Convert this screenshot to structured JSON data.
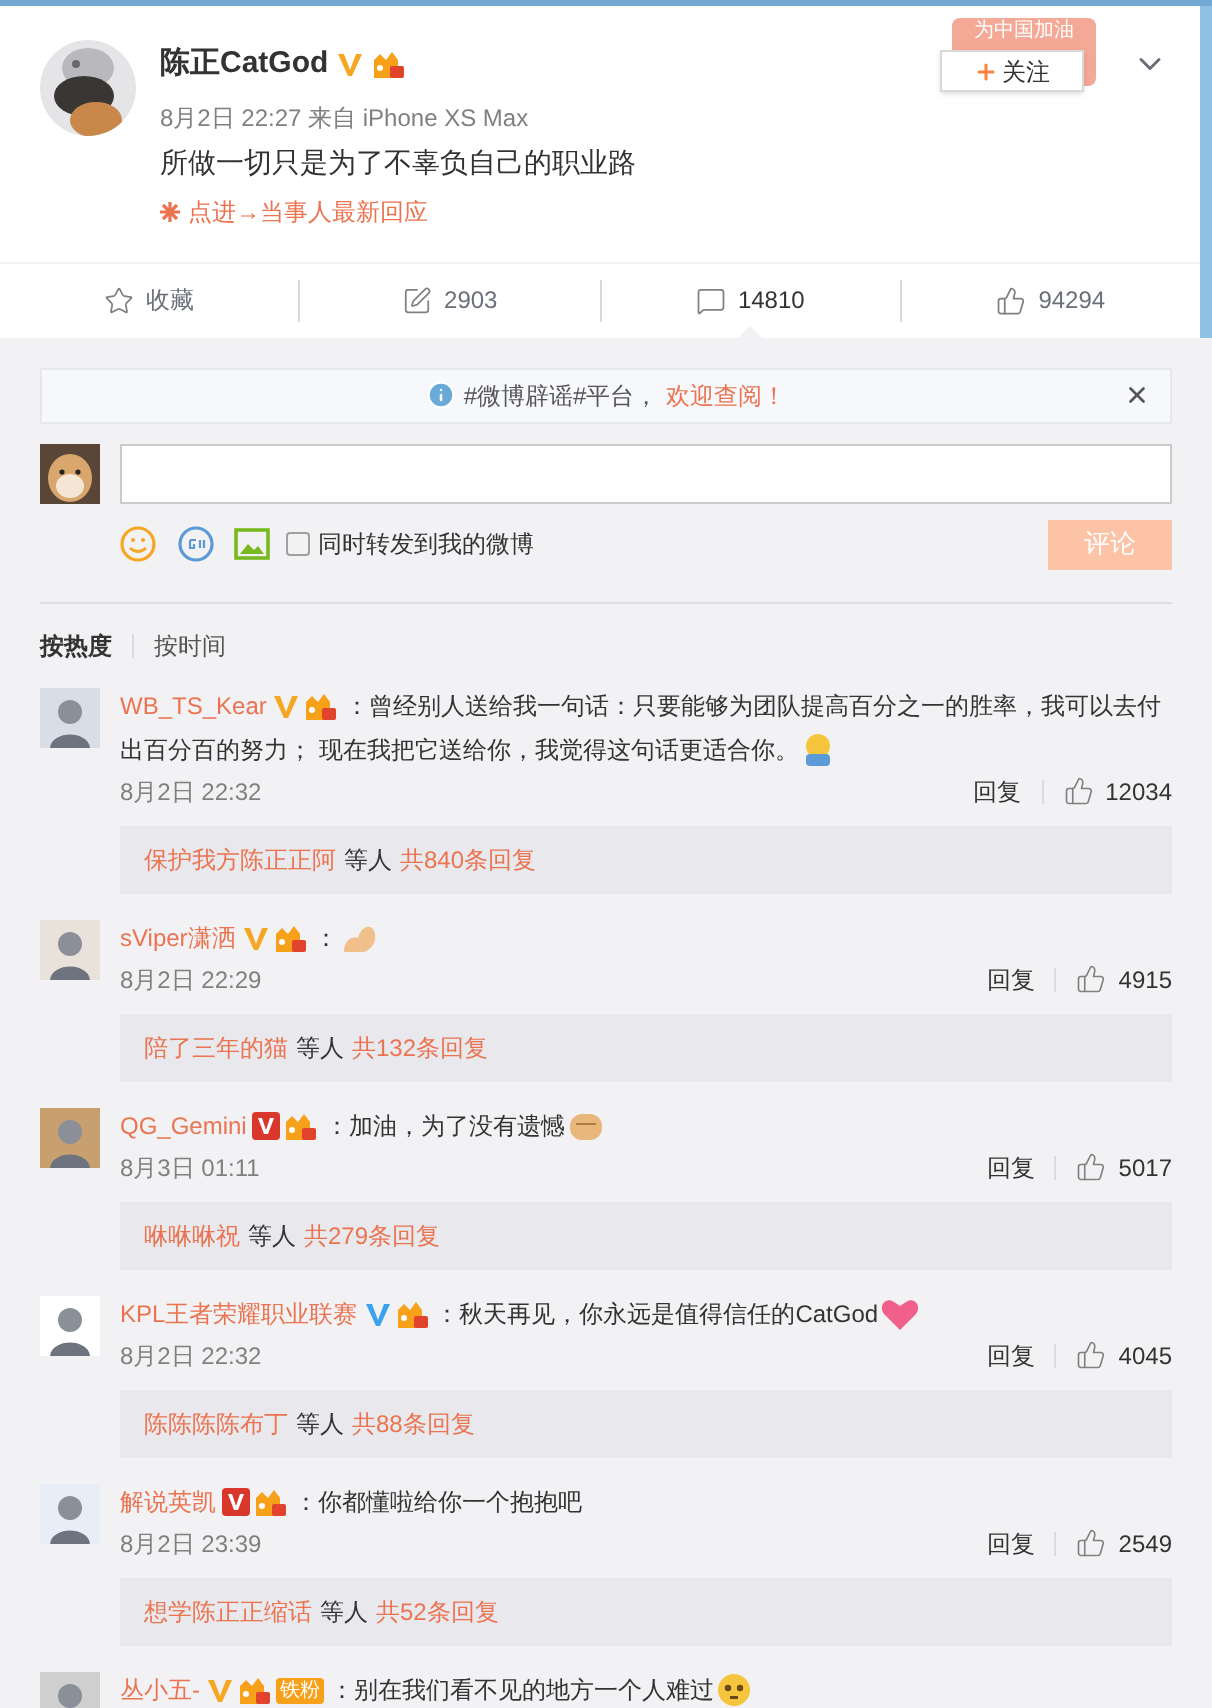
{
  "post": {
    "author": "陈正CatGod",
    "verified": {
      "kind": "gold"
    },
    "member": true,
    "meta": "8月2日 22:27 来自 iPhone XS Max",
    "text": "所做一切只是为了不辜负自己的职业路",
    "link": "点进→当事人最新回应",
    "follow_button": "关注",
    "banner": "为中国加油"
  },
  "actions": [
    {
      "kind": "favorite",
      "label": "收藏",
      "selected": false
    },
    {
      "kind": "repost",
      "label": "2903",
      "selected": false
    },
    {
      "kind": "comment",
      "label": "14810",
      "selected": true
    },
    {
      "kind": "like",
      "label": "94294",
      "selected": false
    }
  ],
  "notice": {
    "text": "#微博辟谣#平台，",
    "link": "欢迎查阅！"
  },
  "composer": {
    "repost_label": "同时转发到我的微博",
    "repost_checked": false,
    "submit": "评论"
  },
  "sort_tabs": [
    {
      "label": "按热度",
      "selected": true
    },
    {
      "label": "按时间",
      "selected": false
    }
  ],
  "comments": [
    {
      "user": "WB_TS_Kear",
      "verified": {
        "kind": "gold"
      },
      "text": "：曾经别人送给我一句话：只要能够为团队提高百分之一的胜率，我可以去付出百分百的努力； 现在我把它送给你，我觉得这句话更适合你。",
      "emoji": {
        "kind": "hug"
      },
      "date": "8月2日 22:32",
      "reply": "回复",
      "likes": "12034",
      "thread": {
        "users": "保护我方陈正正阿",
        "suffix": "等人",
        "count": "共840条回复"
      }
    },
    {
      "user": "sViper潇洒",
      "verified": {
        "kind": "gold"
      },
      "text": "：",
      "emoji": {
        "kind": "muscle"
      },
      "date": "8月2日 22:29",
      "reply": "回复",
      "likes": "4915",
      "thread": {
        "users": "陪了三年的猫",
        "suffix": "等人",
        "count": "共132条回复"
      }
    },
    {
      "user": "QG_Gemini",
      "verified": {
        "kind": "red"
      },
      "text": "：加油，为了没有遗憾",
      "emoji": {
        "kind": "fist"
      },
      "date": "8月3日 01:11",
      "reply": "回复",
      "likes": "5017",
      "thread": {
        "users": "咻咻咻祝",
        "suffix": "等人",
        "count": "共279条回复"
      }
    },
    {
      "user": "KPL王者荣耀职业联赛",
      "verified": {
        "kind": "blue"
      },
      "text": "：秋天再见，你永远是值得信任的CatGod",
      "emoji": {
        "kind": "heart"
      },
      "date": "8月2日 22:32",
      "reply": "回复",
      "likes": "4045",
      "thread": {
        "users": "陈陈陈陈布丁",
        "suffix": "等人",
        "count": "共88条回复"
      }
    },
    {
      "user": "解说英凯",
      "verified": {
        "kind": "red"
      },
      "text": "：你都懂啦给你一个抱抱吧",
      "date": "8月2日 23:39",
      "reply": "回复",
      "likes": "2549",
      "thread": {
        "users": "想学陈正正缩话",
        "suffix": "等人",
        "count": "共52条回复"
      }
    },
    {
      "user": "丛小五-",
      "verified": {
        "kind": "gold"
      },
      "fan_badge": "铁粉",
      "text": "：别在我们看不见的地方一个人难过",
      "emoji": {
        "kind": "awkward"
      }
    }
  ]
}
